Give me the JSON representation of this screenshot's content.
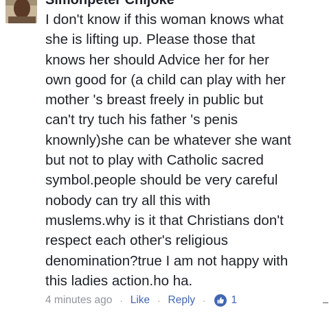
{
  "comment": {
    "author": "Simonpeter Chijoke",
    "lines": [
      "I don't know if this woman knows what",
      "she is lifting up. Please those that",
      "knows her should Advice her for her",
      "own good for (a child can play with her",
      "mother 's breast freely in public but",
      "can't try tuch his father 's penis",
      "knownly)she can be whatever she want",
      "but not to play with Catholic sacred",
      "symbol.people should be very careful",
      "nobody can try all this with",
      "muslems.why is it that Christians don't",
      "respect each other's religious",
      "denomination?true I am not happy with",
      "this ladies action.ho ha."
    ],
    "timestamp": "4 minutes ago",
    "like_label": "Like",
    "reply_label": "Reply",
    "like_count": "1",
    "like_icon": "thumbs-up-icon",
    "separator": "·"
  },
  "colors": {
    "text": "#1d2129",
    "link": "#4267b2",
    "muted": "#90949c",
    "like_badge": "#4267b2"
  }
}
